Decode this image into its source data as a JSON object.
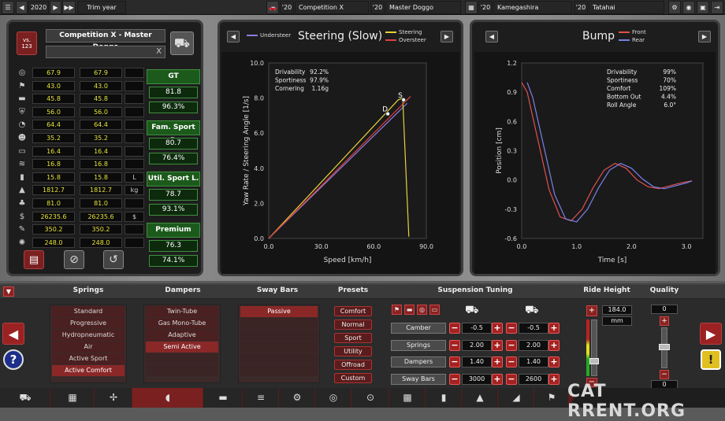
{
  "topbar": {
    "year": "2020",
    "trim_label": "Trim year",
    "slot1_year": "'20",
    "slot1_name": "Competition X",
    "slot2_year": "'20",
    "slot2_name": "Master Doggo",
    "slot3_year": "'20",
    "slot3_name": "Kamegashira",
    "slot4_year": "'20",
    "slot4_name": "Tatahai"
  },
  "left": {
    "vs_label": "vs.",
    "vs_number": "123",
    "title": "Competition X - Master Doggo",
    "search_clear": "X",
    "stats": [
      {
        "icon": "steering-wheel-icon",
        "a": "67.9",
        "b": "67.9",
        "unit": ""
      },
      {
        "icon": "flag-icon",
        "a": "43.0",
        "b": "43.0",
        "unit": ""
      },
      {
        "icon": "seat-icon",
        "a": "45.8",
        "b": "45.8",
        "unit": ""
      },
      {
        "icon": "safety-icon",
        "a": "56.0",
        "b": "56.0",
        "unit": ""
      },
      {
        "icon": "gauge-icon",
        "a": "64.4",
        "b": "64.4",
        "unit": ""
      },
      {
        "icon": "people-icon",
        "a": "35.2",
        "b": "35.2",
        "unit": ""
      },
      {
        "icon": "cargo-icon",
        "a": "16.4",
        "b": "16.4",
        "unit": ""
      },
      {
        "icon": "speed-icon",
        "a": "16.8",
        "b": "16.8",
        "unit": ""
      },
      {
        "icon": "fuel-icon",
        "a": "15.8",
        "b": "15.8",
        "unit": "L"
      },
      {
        "icon": "weight-icon",
        "a": "1812.7",
        "b": "1812.7",
        "unit": "kg"
      },
      {
        "icon": "environment-icon",
        "a": "81.0",
        "b": "81.0",
        "unit": ""
      },
      {
        "icon": "cost-icon",
        "a": "26235.6",
        "b": "26235.6",
        "unit": "$"
      },
      {
        "icon": "tools-icon",
        "a": "350.2",
        "b": "350.2",
        "unit": ""
      },
      {
        "icon": "gears-icon",
        "a": "248.0",
        "b": "248.0",
        "unit": ""
      }
    ],
    "demographics": [
      {
        "name": "GT",
        "score": "81.8",
        "pct": "96.3%"
      },
      {
        "name": "Fam. Sport P.",
        "score": "80.7",
        "pct": "76.4%"
      },
      {
        "name": "Util. Sport L.",
        "score": "78.7",
        "pct": "93.1%"
      },
      {
        "name": "Premium",
        "score": "76.3",
        "pct": "74.1%"
      }
    ]
  },
  "steering_chart": {
    "title": "Steering (Slow)",
    "legend_left": "Understeer",
    "legend_right1": "Steering",
    "legend_right2": "Oversteer",
    "stats": [
      {
        "label": "Drivability",
        "value": "92.2%"
      },
      {
        "label": "Sportiness",
        "value": "97.9%"
      },
      {
        "label": "Cornering",
        "value": "1.16g"
      }
    ],
    "marker_d": "D",
    "marker_s": "S"
  },
  "suspension_chart": {
    "title": "Bump",
    "legend1": "Front",
    "legend2": "Rear",
    "stats": [
      {
        "label": "Drivability",
        "value": "99%"
      },
      {
        "label": "Sportiness",
        "value": "70%"
      },
      {
        "label": "Comfort",
        "value": "109%"
      },
      {
        "label": "Bottom Out",
        "value": "4.4%"
      },
      {
        "label": "Roll Angle",
        "value": "6.0°"
      }
    ]
  },
  "chart_data": [
    {
      "type": "line",
      "title": "Steering (Slow)",
      "xlabel": "Speed [km/h]",
      "ylabel": "Yaw Rate / Steering Angle [1/s]",
      "xlim": [
        0,
        90
      ],
      "ylim": [
        0,
        10
      ],
      "xticks": [
        "0.0",
        "30.0",
        "60.0",
        "90.0"
      ],
      "yticks": [
        "0.0",
        "2.0",
        "4.0",
        "6.0",
        "8.0",
        "10.0"
      ],
      "series": [
        {
          "name": "Understeer",
          "color": "#8a7de0",
          "x": [
            0,
            79
          ],
          "y": [
            0,
            7.7
          ]
        },
        {
          "name": "Steering",
          "color": "#e6d23a",
          "x": [
            0,
            74,
            76.5,
            80
          ],
          "y": [
            0,
            7.9,
            8.0,
            0.1
          ]
        },
        {
          "name": "Oversteer",
          "color": "#e04040",
          "x": [
            0,
            81
          ],
          "y": [
            0,
            8.1
          ]
        }
      ],
      "markers": [
        {
          "label": "D",
          "x": 68,
          "y": 7.1
        },
        {
          "label": "S",
          "x": 77,
          "y": 7.9
        }
      ]
    },
    {
      "type": "line",
      "title": "Bump",
      "xlabel": "Time [s]",
      "ylabel": "Position [cm]",
      "xlim": [
        0,
        3.3
      ],
      "ylim": [
        -0.6,
        1.2
      ],
      "xticks": [
        "0.0",
        "1.0",
        "2.0",
        "3.0"
      ],
      "yticks": [
        "-0.6",
        "-0.3",
        "0.0",
        "0.3",
        "0.6",
        "0.9",
        "1.2"
      ],
      "series": [
        {
          "name": "Front",
          "color": "#e05050",
          "x": [
            0,
            0.1,
            0.3,
            0.5,
            0.7,
            0.9,
            1.1,
            1.3,
            1.5,
            1.7,
            1.9,
            2.1,
            2.3,
            2.5,
            2.7,
            2.9,
            3.1
          ],
          "y": [
            1.0,
            0.9,
            0.4,
            -0.1,
            -0.38,
            -0.42,
            -0.3,
            -0.08,
            0.1,
            0.17,
            0.12,
            0.0,
            -0.07,
            -0.09,
            -0.06,
            -0.03,
            -0.01
          ]
        },
        {
          "name": "Rear",
          "color": "#7a80e8",
          "x": [
            0.1,
            0.2,
            0.4,
            0.6,
            0.8,
            1.0,
            1.2,
            1.4,
            1.6,
            1.8,
            2.0,
            2.2,
            2.4,
            2.6,
            2.8,
            3.0,
            3.1
          ],
          "y": [
            1.0,
            0.85,
            0.35,
            -0.15,
            -0.4,
            -0.43,
            -0.3,
            -0.08,
            0.1,
            0.17,
            0.12,
            0.01,
            -0.07,
            -0.09,
            -0.06,
            -0.03,
            -0.01
          ]
        }
      ]
    }
  ],
  "bottom": {
    "headers": {
      "springs": "Springs",
      "dampers": "Dampers",
      "sway": "Sway Bars",
      "presets": "Presets",
      "tuning": "Suspension Tuning",
      "ride": "Ride Height",
      "quality": "Quality"
    },
    "springs": [
      "Standard",
      "Progressive",
      "Hydropneumatic",
      "Air",
      "Active Sport",
      "Active Comfort"
    ],
    "springs_selected": "Active Comfort",
    "dampers": [
      "Twin-Tube",
      "Gas Mono-Tube",
      "Adaptive",
      "Semi Active"
    ],
    "dampers_selected": "Semi Active",
    "sway": [
      "Passive"
    ],
    "sway_selected": "Passive",
    "presets": [
      "Comfort",
      "Normal",
      "Sport",
      "Utility",
      "Offroad",
      "Custom"
    ],
    "tuning": [
      {
        "label": "Camber",
        "front": "-0.5",
        "rear": "-0.5"
      },
      {
        "label": "Springs",
        "front": "2.00",
        "rear": "2.00"
      },
      {
        "label": "Dampers",
        "front": "1.40",
        "rear": "1.40"
      },
      {
        "label": "Sway Bars",
        "front": "3000",
        "rear": "2600"
      }
    ],
    "ride_height_value": "184.0",
    "ride_height_unit": "mm",
    "quality_top": "0",
    "quality_bottom": "0"
  },
  "watermark": "CAT RRENT.ORG"
}
